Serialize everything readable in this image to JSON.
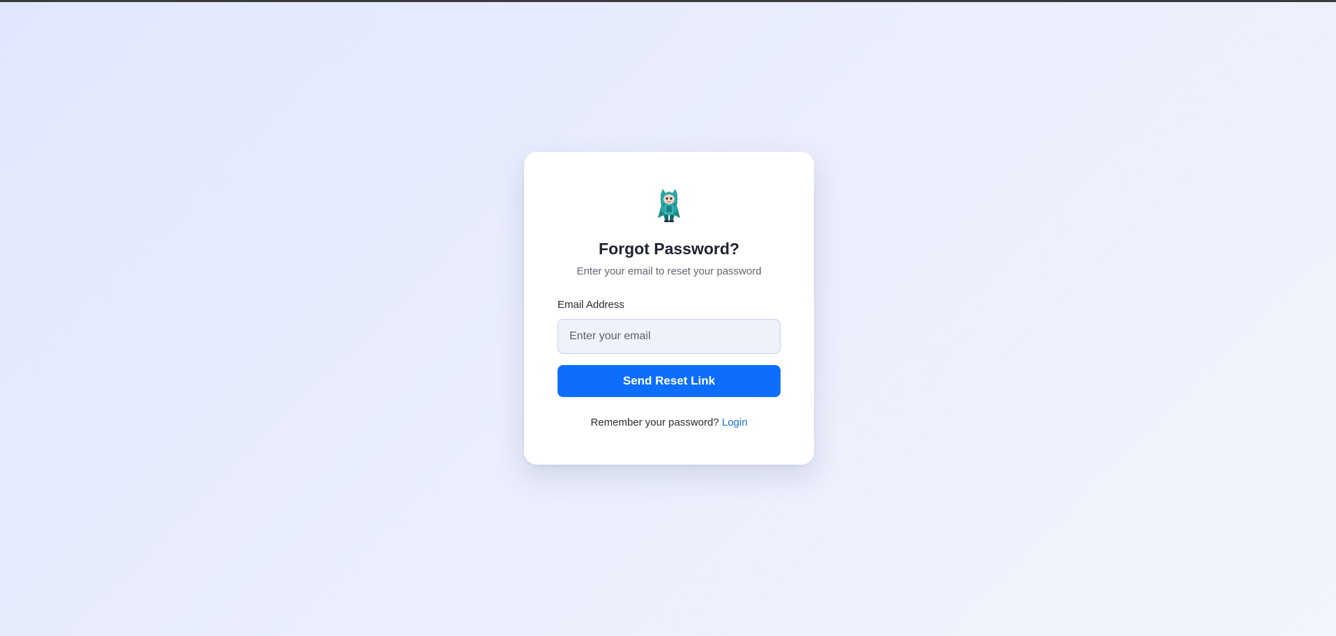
{
  "page": {
    "background_start": "#e1e7fd",
    "background_end": "#f3f5fc"
  },
  "card": {
    "logo_icon": "hooded-character-mascot-icon",
    "title": "Forgot Password?",
    "subtitle": "Enter your email to reset your password",
    "email_label": "Email Address",
    "email_placeholder": "Enter your email",
    "email_value": "",
    "submit_label": "Send Reset Link",
    "footer_text": "Remember your password?",
    "login_link_label": "Login"
  },
  "colors": {
    "primary_button": "#0d6efd",
    "link": "#1a6fe0",
    "input_background": "#eef2fb",
    "input_border": "#c3cdf3"
  }
}
